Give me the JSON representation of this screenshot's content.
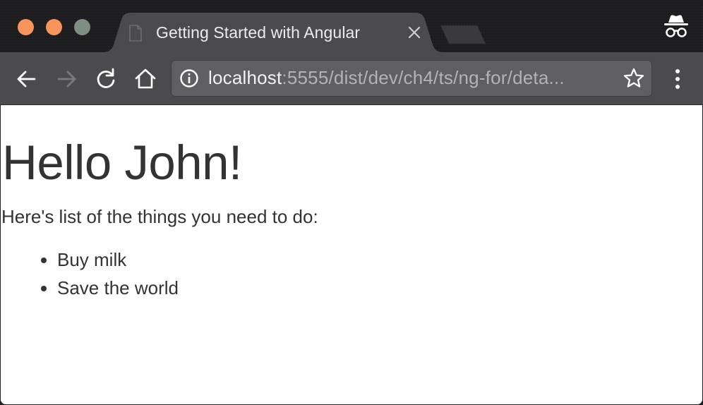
{
  "window": {
    "traffic_lights": {
      "close_color": "#f8935a",
      "minimize_color": "#f8935a",
      "maximize_color": "#7f8f7f"
    }
  },
  "tab": {
    "title": "Getting Started with Angular",
    "favicon": "page-icon",
    "close": "close-icon"
  },
  "toolbar": {
    "back": "arrow-left-icon",
    "forward": "arrow-right-icon",
    "reload": "reload-icon",
    "home": "home-icon",
    "menu": "kebab-menu-icon"
  },
  "omnibox": {
    "url_host": "localhost",
    "url_rest": ":5555/dist/dev/ch4/ts/ng-for/deta...",
    "info": "info-icon",
    "bookmark": "star-icon"
  },
  "incognito": "incognito-icon",
  "page": {
    "heading": "Hello John!",
    "intro": "Here's list of the things you need to do:",
    "todos": [
      "Buy milk",
      "Save the world"
    ]
  },
  "colors": {
    "tab_active": "#4b4b4d",
    "toolbar": "#4b4b4d",
    "omnibox": "#5f5f61",
    "page_text": "#333333"
  }
}
